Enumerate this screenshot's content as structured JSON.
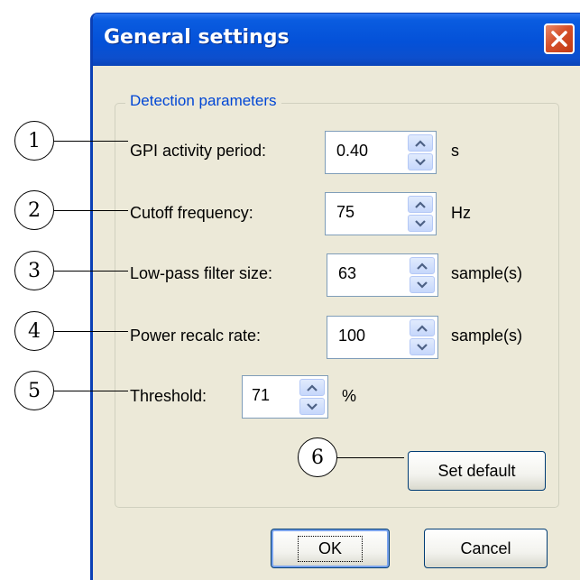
{
  "window": {
    "title": "General settings",
    "close_icon": "close-icon"
  },
  "group": {
    "title": "Detection parameters"
  },
  "fields": [
    {
      "label": "GPI activity period:",
      "value": "0.40",
      "unit": "s"
    },
    {
      "label": "Cutoff frequency:",
      "value": "75",
      "unit": "Hz"
    },
    {
      "label": "Low-pass filter size:",
      "value": "63",
      "unit": "sample(s)"
    },
    {
      "label": "Power recalc rate:",
      "value": "100",
      "unit": "sample(s)"
    },
    {
      "label": "Threshold:",
      "value": "71",
      "unit": "%"
    }
  ],
  "buttons": {
    "set_default": "Set default",
    "ok": "OK",
    "cancel": "Cancel"
  },
  "callouts": [
    "1",
    "2",
    "3",
    "4",
    "5",
    "6"
  ],
  "colors": {
    "titlebar": "#0451d8",
    "close_button": "#d5502a",
    "dialog_background": "#ece9d8",
    "group_title": "#0046d5"
  }
}
